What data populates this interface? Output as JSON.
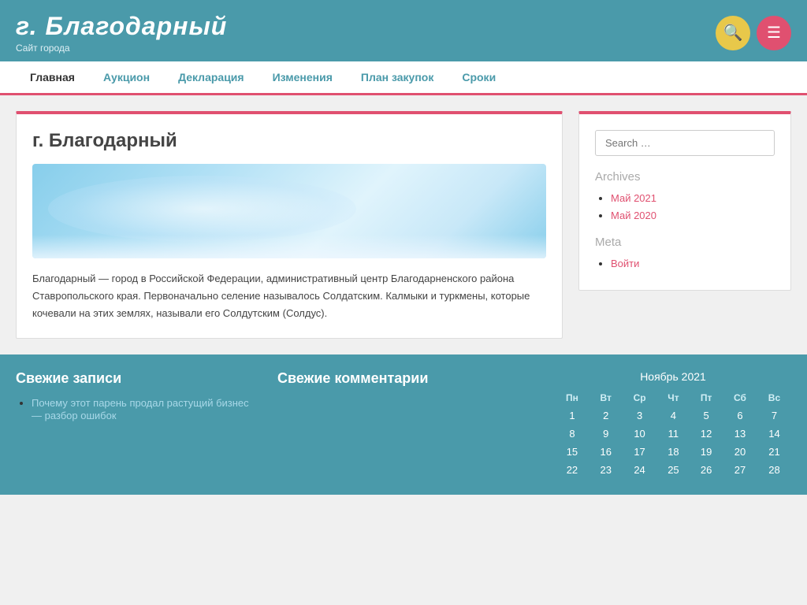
{
  "header": {
    "title": "г. Благодарный",
    "subtitle": "Сайт города",
    "search_icon": "🔍",
    "menu_icon": "☰"
  },
  "nav": {
    "items": [
      {
        "label": "Главная",
        "active": true
      },
      {
        "label": "Аукцион",
        "active": false
      },
      {
        "label": "Декларация",
        "active": false
      },
      {
        "label": "Изменения",
        "active": false
      },
      {
        "label": "План закупок",
        "active": false
      },
      {
        "label": "Сроки",
        "active": false
      }
    ]
  },
  "article": {
    "title": "г. Благодарный",
    "text": "Благодарный — город в Российской Федерации, административный центр Благодарненского района Ставропольского края. Первоначально селение называлось Солдатским. Калмыки и туркмены, которые кочевали на этих землях, называли его Солдутским (Солдус)."
  },
  "sidebar": {
    "search_placeholder": "Search …",
    "archives_title": "Archives",
    "archives": [
      {
        "label": "Май 2021"
      },
      {
        "label": "Май 2020"
      }
    ],
    "meta_title": "Meta",
    "meta_links": [
      {
        "label": "Войти"
      }
    ]
  },
  "footer": {
    "recent_posts_title": "Свежие записи",
    "recent_posts": [
      {
        "label": "Почему этот парень продал растущий бизнес — разбор ошибок"
      }
    ],
    "recent_comments_title": "Свежие комментарии",
    "recent_comments": [],
    "calendar": {
      "title": "Ноябрь 2021",
      "headers": [
        "Пн",
        "Вт",
        "Ср",
        "Чт",
        "Пт",
        "Сб",
        "Вс"
      ],
      "rows": [
        [
          "1",
          "2",
          "3",
          "4",
          "5",
          "6",
          "7"
        ],
        [
          "8",
          "9",
          "10",
          "11",
          "12",
          "13",
          "14"
        ],
        [
          "15",
          "16",
          "17",
          "18",
          "19",
          "20",
          "21"
        ],
        [
          "22",
          "23",
          "24",
          "25",
          "26",
          "27",
          "28"
        ]
      ]
    }
  }
}
